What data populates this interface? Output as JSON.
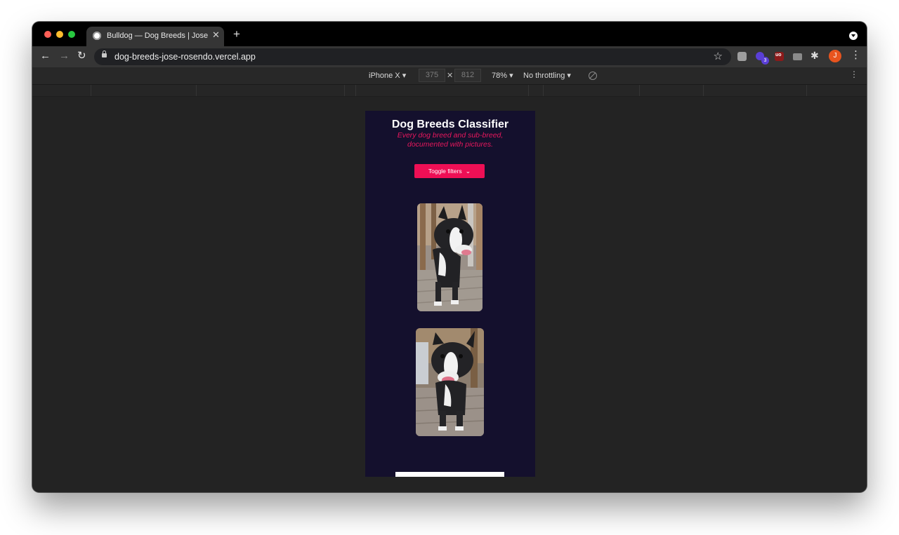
{
  "browser": {
    "tab_title": "Bulldog — Dog Breeds | Jose R",
    "url": "dog-breeds-jose-rosendo.vercel.app",
    "extension_badge": "3",
    "extension_label": "uo",
    "avatar_initial": "J"
  },
  "devtools": {
    "device": "iPhone X ▾",
    "width": "375",
    "height": "812",
    "zoom": "78% ▾",
    "throttling": "No throttling ▾"
  },
  "app": {
    "title": "Dog Breeds Classifier",
    "subtitle": "Every dog breed and sub-breed, documented with pictures.",
    "toggle_label": "Toggle filters",
    "accent_color": "#ee0f55",
    "background_color": "#14102d"
  }
}
